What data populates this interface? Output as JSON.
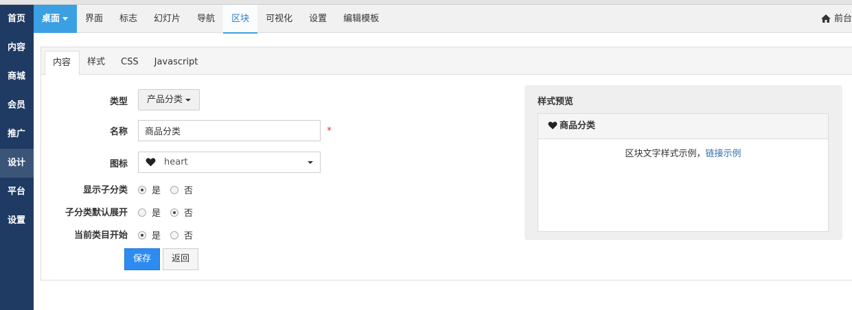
{
  "sidebar": {
    "items": [
      {
        "label": "首页"
      },
      {
        "label": "内容"
      },
      {
        "label": "商城"
      },
      {
        "label": "会员"
      },
      {
        "label": "推广"
      },
      {
        "label": "设计",
        "active": true
      },
      {
        "label": "平台"
      },
      {
        "label": "设置"
      }
    ]
  },
  "topbar": {
    "brand": "桌面",
    "menu": [
      {
        "label": "界面"
      },
      {
        "label": "标志"
      },
      {
        "label": "幻灯片"
      },
      {
        "label": "导航"
      },
      {
        "label": "区块",
        "active": true
      },
      {
        "label": "可视化"
      },
      {
        "label": "设置"
      },
      {
        "label": "编辑模板"
      }
    ],
    "front_link": "前台"
  },
  "tabs": [
    {
      "label": "内容",
      "active": true
    },
    {
      "label": "样式"
    },
    {
      "label": "CSS"
    },
    {
      "label": "Javascript"
    }
  ],
  "form": {
    "type_label": "类型",
    "type_value": "产品分类",
    "name_label": "名称",
    "name_value": "商品分类",
    "required_mark": "*",
    "icon_label": "图标",
    "icon_value": "heart",
    "icon_name": "heart-icon",
    "show_children_label": "显示子分类",
    "expand_default_label": "子分类默认展开",
    "current_start_label": "当前类目开始",
    "yes": "是",
    "no": "否",
    "show_children": "yes",
    "expand_default": "no",
    "current_start": "yes",
    "save_label": "保存",
    "back_label": "返回"
  },
  "preview": {
    "title": "样式预览",
    "box_title": "商品分类",
    "sample_text": "区块文字样式示例，",
    "sample_link": "链接示例"
  },
  "colors": {
    "sidebar_bg": "#1f3a63",
    "brand_bg": "#3aa0e2",
    "primary_button": "#2e8cf0",
    "link": "#2f6da8",
    "required": "#ee3333"
  }
}
